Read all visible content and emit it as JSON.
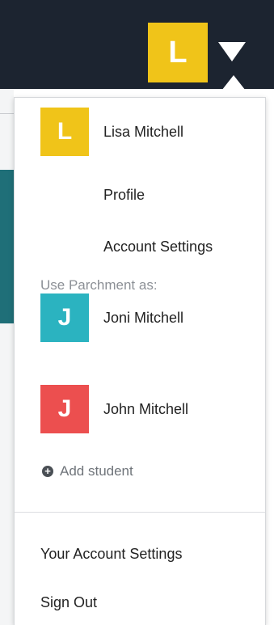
{
  "topbar": {
    "avatar_initial": "L",
    "avatar_color": "#f0c419",
    "menu_icon": "caret-down-icon"
  },
  "dropdown": {
    "current_user": {
      "initial": "L",
      "name": "Lisa Mitchell",
      "color": "#f0c419"
    },
    "profile_label": "Profile",
    "account_settings_label": "Account Settings",
    "use_as_label": "Use Parchment as:",
    "students": [
      {
        "initial": "J",
        "name": "Joni Mitchell",
        "color": "#2bb3c0"
      },
      {
        "initial": "J",
        "name": "John Mitchell",
        "color": "#ec4f4f"
      }
    ],
    "add_student_label": "Add student",
    "your_account_settings_label": "Your Account Settings",
    "sign_out_label": "Sign Out"
  }
}
